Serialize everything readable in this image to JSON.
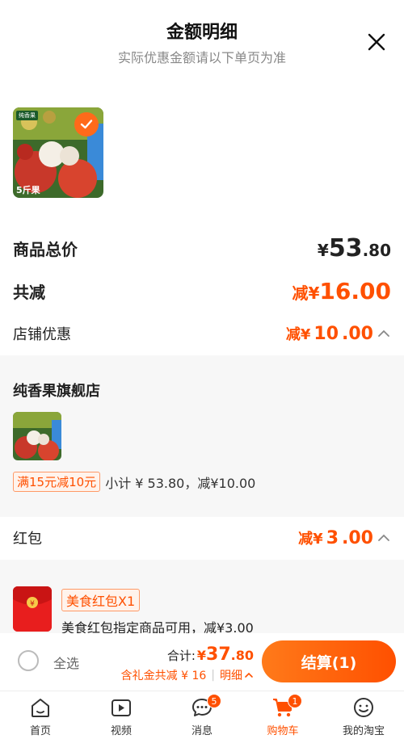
{
  "header": {
    "title": "金额明细",
    "subtitle": "实际优惠金额请以下单页为准"
  },
  "product": {
    "thumb_count": "5斤果",
    "thumb_tag": "纯香果"
  },
  "summary": {
    "total_label": "商品总价",
    "total_currency": "¥",
    "total_int": "53",
    "total_dec": ".80",
    "discount_label": "共减",
    "discount_prefix": "减¥",
    "discount_int": "16",
    "discount_dec": ".00"
  },
  "store_discount": {
    "label": "店铺优惠",
    "prefix": "减¥",
    "int": "10",
    "dec": ".00"
  },
  "store": {
    "name": "纯香果旗舰店",
    "promo_tag": "满15元减10元",
    "promo_text": "小计 ¥ 53.80，减¥10.00"
  },
  "red_packet": {
    "label": "红包",
    "prefix": "减¥",
    "int": "3",
    "dec": ".00",
    "tag": "美食红包X1",
    "desc": "美食红包指定商品可用，减¥3.00"
  },
  "checkout": {
    "select_all": "全选",
    "sum_label": "合计:",
    "sum_currency": "¥",
    "sum_int": "37",
    "sum_dec": ".80",
    "sub_text": "含礼金共减 ¥ 16",
    "detail_link": "明细",
    "pay_button": "结算(1)"
  },
  "tabs": [
    {
      "label": "首页",
      "icon": "home-icon",
      "badge": ""
    },
    {
      "label": "视频",
      "icon": "video-icon",
      "badge": ""
    },
    {
      "label": "消息",
      "icon": "message-icon",
      "badge": "5"
    },
    {
      "label": "购物车",
      "icon": "cart-icon",
      "badge": "1"
    },
    {
      "label": "我的淘宝",
      "icon": "profile-icon",
      "badge": ""
    }
  ],
  "colors": {
    "accent": "#ff5000",
    "accent_light": "#ff7a1a"
  }
}
